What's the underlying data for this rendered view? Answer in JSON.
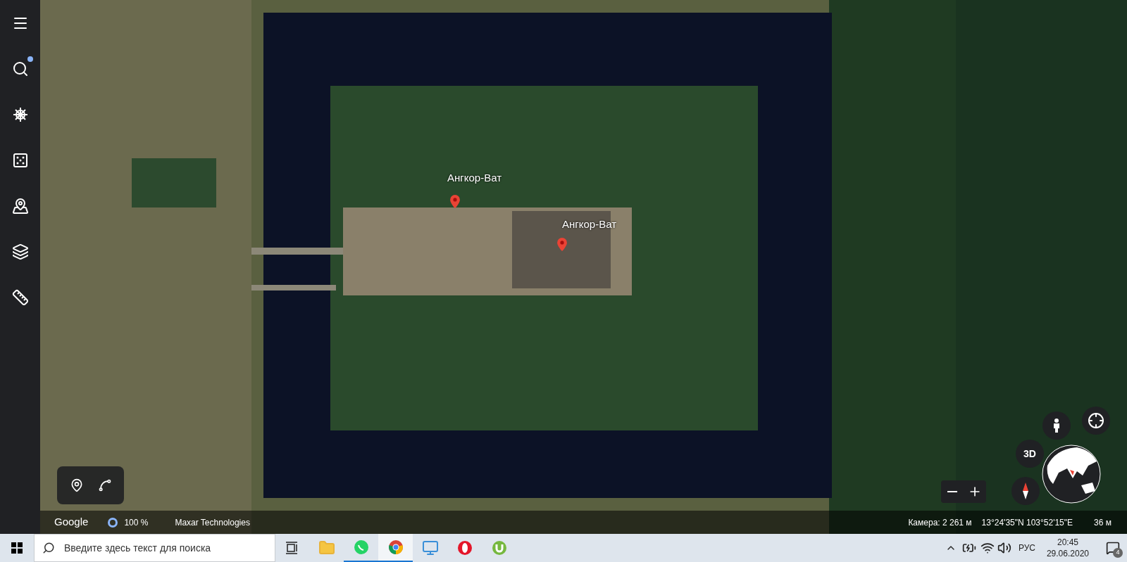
{
  "sidebar": {
    "items": [
      {
        "kind": "menu",
        "notification": false
      },
      {
        "kind": "search",
        "notification": true
      },
      {
        "kind": "voyager",
        "notification": false
      },
      {
        "kind": "lucky",
        "notification": false
      },
      {
        "kind": "projects",
        "notification": false
      },
      {
        "kind": "layers",
        "notification": false
      },
      {
        "kind": "measure",
        "notification": false
      }
    ]
  },
  "map": {
    "places": [
      {
        "label": "Ангкор-Ват"
      },
      {
        "label": "Ангкор-Ват"
      }
    ],
    "controls": {
      "three_d": "3D"
    },
    "status_bar": {
      "logo": "Google",
      "progress": "100 %",
      "attribution": "Maxar Technologies",
      "camera": "Камера: 2 261 м",
      "coordinates": "13°24'35\"N 103°52'15\"E",
      "scale": "36 м"
    }
  },
  "taskbar": {
    "search": {
      "placeholder": "Введите здесь текст для поиска"
    },
    "apps": [
      {
        "kind": "explorer",
        "running": false,
        "selected": false
      },
      {
        "kind": "whatsapp",
        "running": true,
        "selected": false
      },
      {
        "kind": "chrome",
        "running": true,
        "selected": true
      },
      {
        "kind": "computer",
        "running": false,
        "selected": false
      },
      {
        "kind": "opera",
        "running": false,
        "selected": false
      },
      {
        "kind": "utorrent",
        "running": false,
        "selected": false
      }
    ],
    "tray": {
      "language": "РУС",
      "time": "20:45",
      "date": "29.06.2020",
      "notifications": "4"
    }
  }
}
